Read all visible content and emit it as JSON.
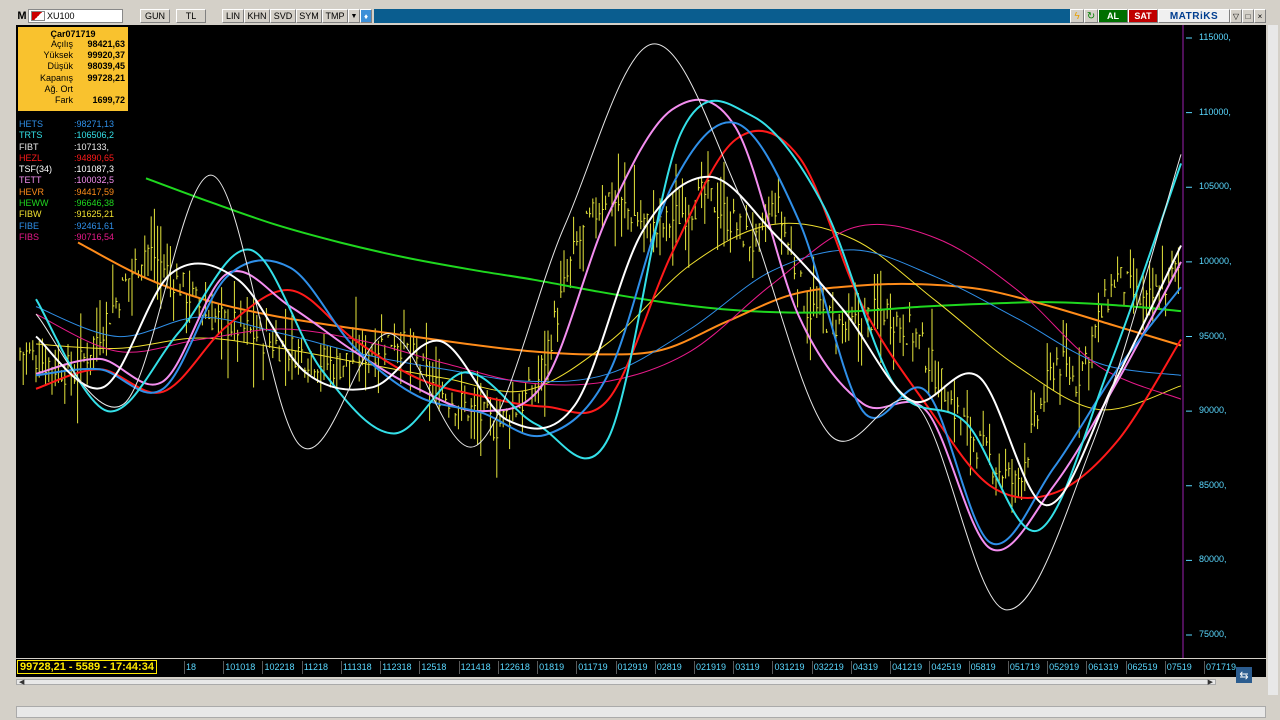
{
  "toolbar": {
    "logo": "M",
    "symbol": "XU100",
    "buttons": [
      "GUN",
      "TL",
      "LIN",
      "KHN",
      "SVD",
      "SYM",
      "TMP"
    ],
    "al_label": "AL",
    "sat_label": "SAT",
    "brand": "MATRiKS"
  },
  "info_box": {
    "title": "Çar071719",
    "rows": [
      {
        "label": "Açılış",
        "value": "98421,63"
      },
      {
        "label": "Yüksek",
        "value": "99920,37"
      },
      {
        "label": "Düşük",
        "value": "98039,45"
      },
      {
        "label": "Kapanış",
        "value": "99728,21"
      },
      {
        "label": "Ağ. Ort",
        "value": ""
      },
      {
        "label": "Fark",
        "value": "1699,72"
      }
    ]
  },
  "legend": [
    {
      "name": "HETS",
      "value": ":98271,13",
      "color": "#2f8fe8"
    },
    {
      "name": "TRTS",
      "value": ":106506,2",
      "color": "#34e0e8"
    },
    {
      "name": "FIBT",
      "value": ":107133,",
      "color": "#e8e8e8"
    },
    {
      "name": "HEZL",
      "value": ":94890,65",
      "color": "#ff1a1a"
    },
    {
      "name": "TSF(34)",
      "value": ":101087,3",
      "color": "#ffffff"
    },
    {
      "name": "TETT",
      "value": ":100032,5",
      "color": "#f48ef0"
    },
    {
      "name": "HEVR",
      "value": ":94417,59",
      "color": "#ff8c1a"
    },
    {
      "name": "HEWW",
      "value": ":96646,38",
      "color": "#1fd81f"
    },
    {
      "name": "FIBW",
      "value": ":91625,21",
      "color": "#f0e030"
    },
    {
      "name": "FIBE",
      "value": ":92461,61",
      "color": "#2f8fe8"
    },
    {
      "name": "FIBS",
      "value": ":90716,54",
      "color": "#e81a8a"
    }
  ],
  "y_axis": {
    "labels": [
      "115000,",
      "110000,",
      "105000,",
      "100000,",
      "95000,",
      "90000,",
      "85000,",
      "80000,",
      "75000,"
    ]
  },
  "status_text": "99728,21 - 5589 - 17:44:34",
  "x_axis": {
    "labels": [
      "18",
      "101018",
      "102218",
      "11218",
      "111318",
      "112318",
      "12518",
      "121418",
      "122618",
      "01819",
      "011719",
      "012919",
      "02819",
      "021919",
      "03119",
      "031219",
      "032219",
      "04319",
      "041219",
      "042519",
      "05819",
      "051719",
      "052919",
      "061319",
      "062519",
      "07519",
      "071719"
    ]
  },
  "chart_data": {
    "type": "line",
    "ylim": [
      74000,
      116500
    ],
    "y_ticks": [
      115000,
      110000,
      105000,
      100000,
      95000,
      90000,
      85000,
      80000,
      75000
    ],
    "series": [
      {
        "name": "HEWW",
        "color": "#1fd81f",
        "width": 2,
        "x0": 130,
        "values": [
          105600,
          104000,
          102500,
          101300,
          100300,
          99500,
          98800,
          98000,
          97300,
          96800,
          96600,
          96700,
          97000,
          97200,
          97300,
          97100,
          96700
        ]
      },
      {
        "name": "HEVR",
        "color": "#ff8c1a",
        "width": 2,
        "x0": 62,
        "values": [
          101300,
          99000,
          97400,
          96400,
          95700,
          95100,
          94500,
          94000,
          93800,
          94100,
          96000,
          97800,
          98400,
          98500,
          98100,
          97000,
          95700,
          94400
        ]
      },
      {
        "name": "FIBW",
        "color": "#f0e030",
        "width": 1,
        "x0": 20,
        "values": [
          94500,
          94200,
          94900,
          94200,
          93200,
          92200,
          91400,
          94600,
          99800,
          102500,
          101500,
          97400,
          93000,
          90100,
          91700
        ]
      },
      {
        "name": "FIBE",
        "color": "#2f8fe8",
        "width": 1,
        "x0": 20,
        "values": [
          97000,
          95000,
          96300,
          95200,
          93800,
          92800,
          92000,
          92500,
          95500,
          99400,
          100800,
          99000,
          96200,
          93200,
          92400
        ]
      },
      {
        "name": "FIBS",
        "color": "#e81a8a",
        "width": 1,
        "x0": 20,
        "values": [
          96500,
          94000,
          94800,
          95500,
          94700,
          93200,
          91900,
          92000,
          94000,
          98500,
          102300,
          101600,
          98100,
          93000,
          90800
        ]
      },
      {
        "name": "HEZL",
        "color": "#ff1a1a",
        "width": 2,
        "x0": 20,
        "values": [
          91500,
          92800,
          91300,
          95700,
          98100,
          94800,
          92200,
          91000,
          90300,
          90800,
          100600,
          108200,
          107000,
          97000,
          90400,
          85000,
          84500,
          88000,
          94800
        ]
      },
      {
        "name": "TETT",
        "color": "#f48ef0",
        "width": 2,
        "x0": 20,
        "values": [
          92500,
          93500,
          92000,
          99200,
          97000,
          94000,
          91500,
          90000,
          92000,
          103200,
          110200,
          109000,
          96300,
          90500,
          90000,
          80800,
          85000,
          92000,
          100000
        ]
      },
      {
        "name": "HETS",
        "color": "#2f8fe8",
        "width": 2,
        "x0": 20,
        "values": [
          92400,
          92800,
          91500,
          99000,
          99600,
          94300,
          91000,
          89900,
          88400,
          92500,
          105100,
          109300,
          102700,
          90000,
          91300,
          81200,
          86200,
          92800,
          98300
        ]
      },
      {
        "name": "TRTS",
        "color": "#34e0e8",
        "width": 2,
        "x0": 20,
        "values": [
          97500,
          90000,
          95300,
          100800,
          92700,
          88500,
          92600,
          89100,
          88200,
          108500,
          109800,
          103800,
          91700,
          89200,
          82000,
          93000,
          106600
        ]
      },
      {
        "name": "TSF(34)",
        "color": "#ffffff",
        "width": 2,
        "x0": 20,
        "values": [
          95000,
          91600,
          99200,
          98800,
          92600,
          91600,
          94700,
          89400,
          90400,
          102000,
          105700,
          101700,
          96700,
          90700,
          92300,
          83700,
          91800,
          101100
        ]
      },
      {
        "name": "FIBT",
        "color": "#e8e8e8",
        "width": 1,
        "x0": 20,
        "values": [
          96500,
          90500,
          105800,
          87700,
          95200,
          87700,
          102400,
          114600,
          104300,
          88500,
          90400,
          76700,
          87900,
          107200
        ]
      }
    ]
  }
}
